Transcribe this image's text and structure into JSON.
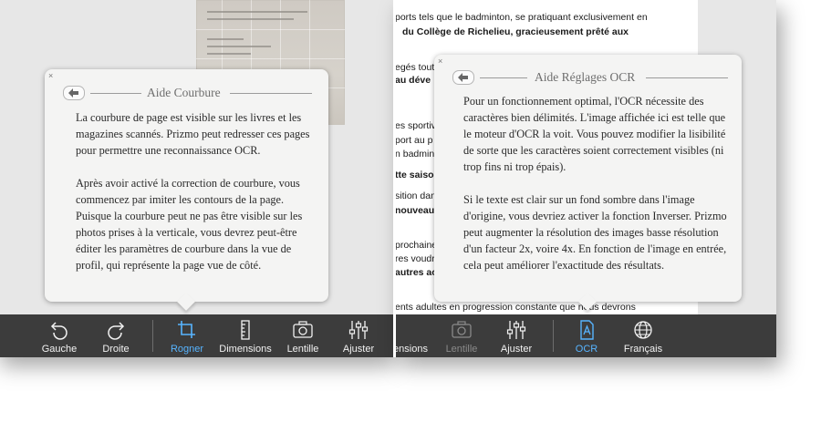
{
  "left_pane": {
    "toolbar": [
      {
        "id": "gauche",
        "label": "Gauche",
        "icon": "rotate-left-icon"
      },
      {
        "id": "droite",
        "label": "Droite",
        "icon": "rotate-right-icon"
      },
      {
        "id": "rogner",
        "label": "Rogner",
        "icon": "crop-icon",
        "active": true
      },
      {
        "id": "dimensions",
        "label": "Dimensions",
        "icon": "ruler-icon"
      },
      {
        "id": "lentille",
        "label": "Lentille",
        "icon": "camera-icon"
      },
      {
        "id": "ajuster",
        "label": "Ajuster",
        "icon": "sliders-icon"
      }
    ],
    "popover": {
      "close": "×",
      "title": "Aide Courbure",
      "paragraphs": [
        "La courbure de page est visible sur les livres et les magazines scannés. Prizmo peut redresser ces pages pour permettre une reconnaissance OCR.",
        "Après avoir activé la correction de courbure, vous commencez par imiter les contours de la page. Puisque la courbure peut ne pas être visible sur les photos prises à la verticale, vous devrez peut-être éditer les paramètres de courbure dans la vue de profil, qui représente la page vue de côté."
      ]
    }
  },
  "right_pane": {
    "document_lines": [
      {
        "text": "ports tels que le badminton, se pratiquant exclusivement en",
        "bold": false
      },
      {
        "text": "du Collège de Richelieu, gracieusement prêté aux",
        "bold": true
      },
      {
        "text": "egés tout",
        "bold": false
      },
      {
        "text": "au déve",
        "bold": true
      },
      {
        "text": "es sportiv",
        "bold": false
      },
      {
        "text": "port au p",
        "bold": false
      },
      {
        "text": "n badmin",
        "bold": false
      },
      {
        "text": "tte saiso",
        "bold": true
      },
      {
        "text": "sition dan",
        "bold": false
      },
      {
        "text": "nouveau",
        "bold": true
      },
      {
        "text": "prochaine",
        "bold": false
      },
      {
        "text": "res voudr",
        "bold": false
      },
      {
        "text": "autres ac",
        "bold": true
      },
      {
        "text": "ents adultes en progression constante que nous devrons",
        "bold": false
      }
    ],
    "toolbar": [
      {
        "id": "dimensions",
        "label": "ensions",
        "icon": "ruler-icon"
      },
      {
        "id": "lentille",
        "label": "Lentille",
        "icon": "camera-icon",
        "disabled": true
      },
      {
        "id": "ajuster",
        "label": "Ajuster",
        "icon": "sliders-icon"
      },
      {
        "id": "ocr",
        "label": "OCR",
        "icon": "ocr-document-icon",
        "active": true
      },
      {
        "id": "francais",
        "label": "Français",
        "icon": "globe-icon"
      }
    ],
    "popover": {
      "close": "×",
      "title": "Aide Réglages OCR",
      "paragraphs": [
        "Pour un fonctionnement optimal, l'OCR nécessite des caractères bien délimités. L'image affichée ici est telle que le moteur d'OCR la voit. Vous pouvez modifier la lisibilité de sorte que les caractères soient correctement visibles (ni trop fins ni trop épais).",
        "Si le texte est clair sur un fond sombre dans l'image d'origine, vous devriez activer la fonction Inverser. Prizmo peut augmenter la résolution des images basse résolution d'un facteur 2x, voire 4x. En fonction de l'image en entrée, cela peut améliorer l'exactitude des résultats."
      ]
    }
  },
  "colors": {
    "toolbar_bg": "#3c3c3c",
    "active": "#57b4ff",
    "popover_bg": "#f4f4f3"
  }
}
